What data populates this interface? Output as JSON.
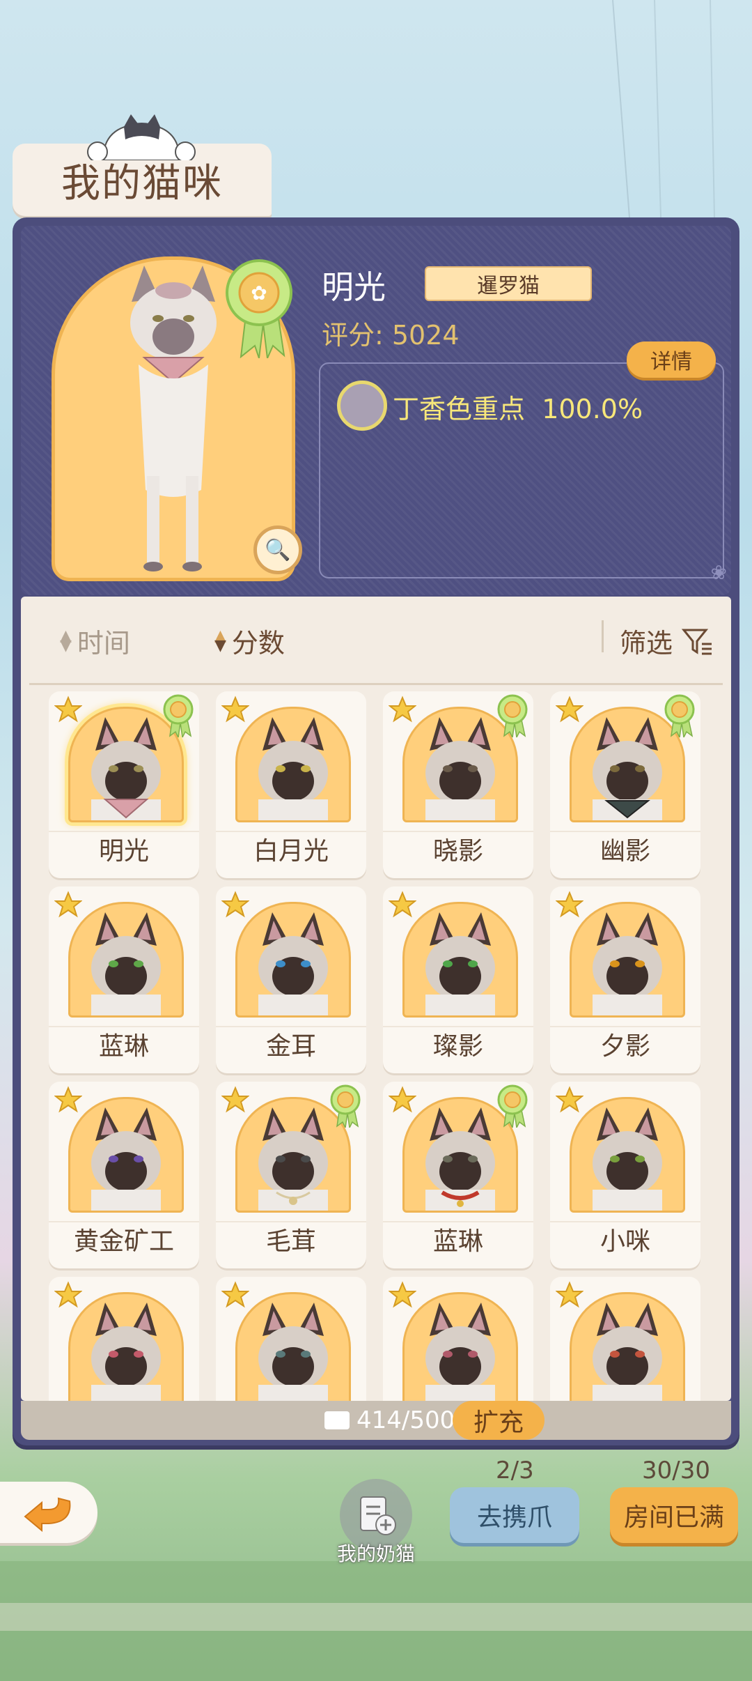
{
  "header": {
    "title": "我的猫咪"
  },
  "selected_cat": {
    "name": "明光",
    "breed": "暹罗猫",
    "score_label": "评分: 5024",
    "detail_label": "详情",
    "gene": {
      "label": "丁香色重点",
      "percent": "100.0%",
      "color": "#a9a0b3"
    }
  },
  "sort": {
    "time_label": "时间",
    "score_label": "分数",
    "filter_label": "筛选"
  },
  "cats": [
    {
      "name": "明光",
      "rosette": true,
      "selected": true,
      "eye": "#9c8f55",
      "accessory": "scarf"
    },
    {
      "name": "白月光",
      "rosette": false,
      "selected": false,
      "eye": "#c9b34a",
      "accessory": ""
    },
    {
      "name": "晓影",
      "rosette": true,
      "selected": false,
      "eye": "#6a5b4a",
      "accessory": ""
    },
    {
      "name": "幽影",
      "rosette": true,
      "selected": false,
      "eye": "#7c6a3c",
      "accessory": "scarf-dark"
    },
    {
      "name": "蓝琳",
      "rosette": false,
      "selected": false,
      "eye": "#5fa849",
      "accessory": ""
    },
    {
      "name": "金耳",
      "rosette": false,
      "selected": false,
      "eye": "#3d8ec9",
      "accessory": ""
    },
    {
      "name": "璨影",
      "rosette": false,
      "selected": false,
      "eye": "#4fa64a",
      "accessory": ""
    },
    {
      "name": "夕影",
      "rosette": false,
      "selected": false,
      "eye": "#d9941c",
      "accessory": ""
    },
    {
      "name": "黄金矿工",
      "rosette": false,
      "selected": false,
      "eye": "#6a4fa8",
      "accessory": ""
    },
    {
      "name": "毛茸",
      "rosette": true,
      "selected": false,
      "eye": "#4a4a4a",
      "accessory": "necklace"
    },
    {
      "name": "蓝琳",
      "rosette": true,
      "selected": false,
      "eye": "#6b6b5a",
      "accessory": "collar"
    },
    {
      "name": "小咪",
      "rosette": false,
      "selected": false,
      "eye": "#79a03d",
      "accessory": ""
    },
    {
      "name": "",
      "rosette": false,
      "selected": false,
      "eye": "#c35a6a",
      "accessory": ""
    },
    {
      "name": "",
      "rosette": false,
      "selected": false,
      "eye": "#5a7a7a",
      "accessory": ""
    },
    {
      "name": "",
      "rosette": false,
      "selected": false,
      "eye": "#b05a6a",
      "accessory": ""
    },
    {
      "name": "",
      "rosette": false,
      "selected": false,
      "eye": "#c4553e",
      "accessory": ""
    }
  ],
  "capacity": {
    "text": "414/500",
    "expand_label": "扩充"
  },
  "footer": {
    "kitten_label": "我的奶猫",
    "go_count": "2/3",
    "go_label": "去携爪",
    "room_count": "30/30",
    "room_label": "房间已满"
  },
  "icons": [
    "back-arrow-icon",
    "magnify-icon",
    "rosette-icon",
    "star-icon",
    "filter-icon",
    "fish-icon",
    "kitten-add-icon"
  ],
  "colors": {
    "accent": "#f4b24a",
    "panel": "#4c4d7c",
    "gene_text": "#f7e77a"
  }
}
